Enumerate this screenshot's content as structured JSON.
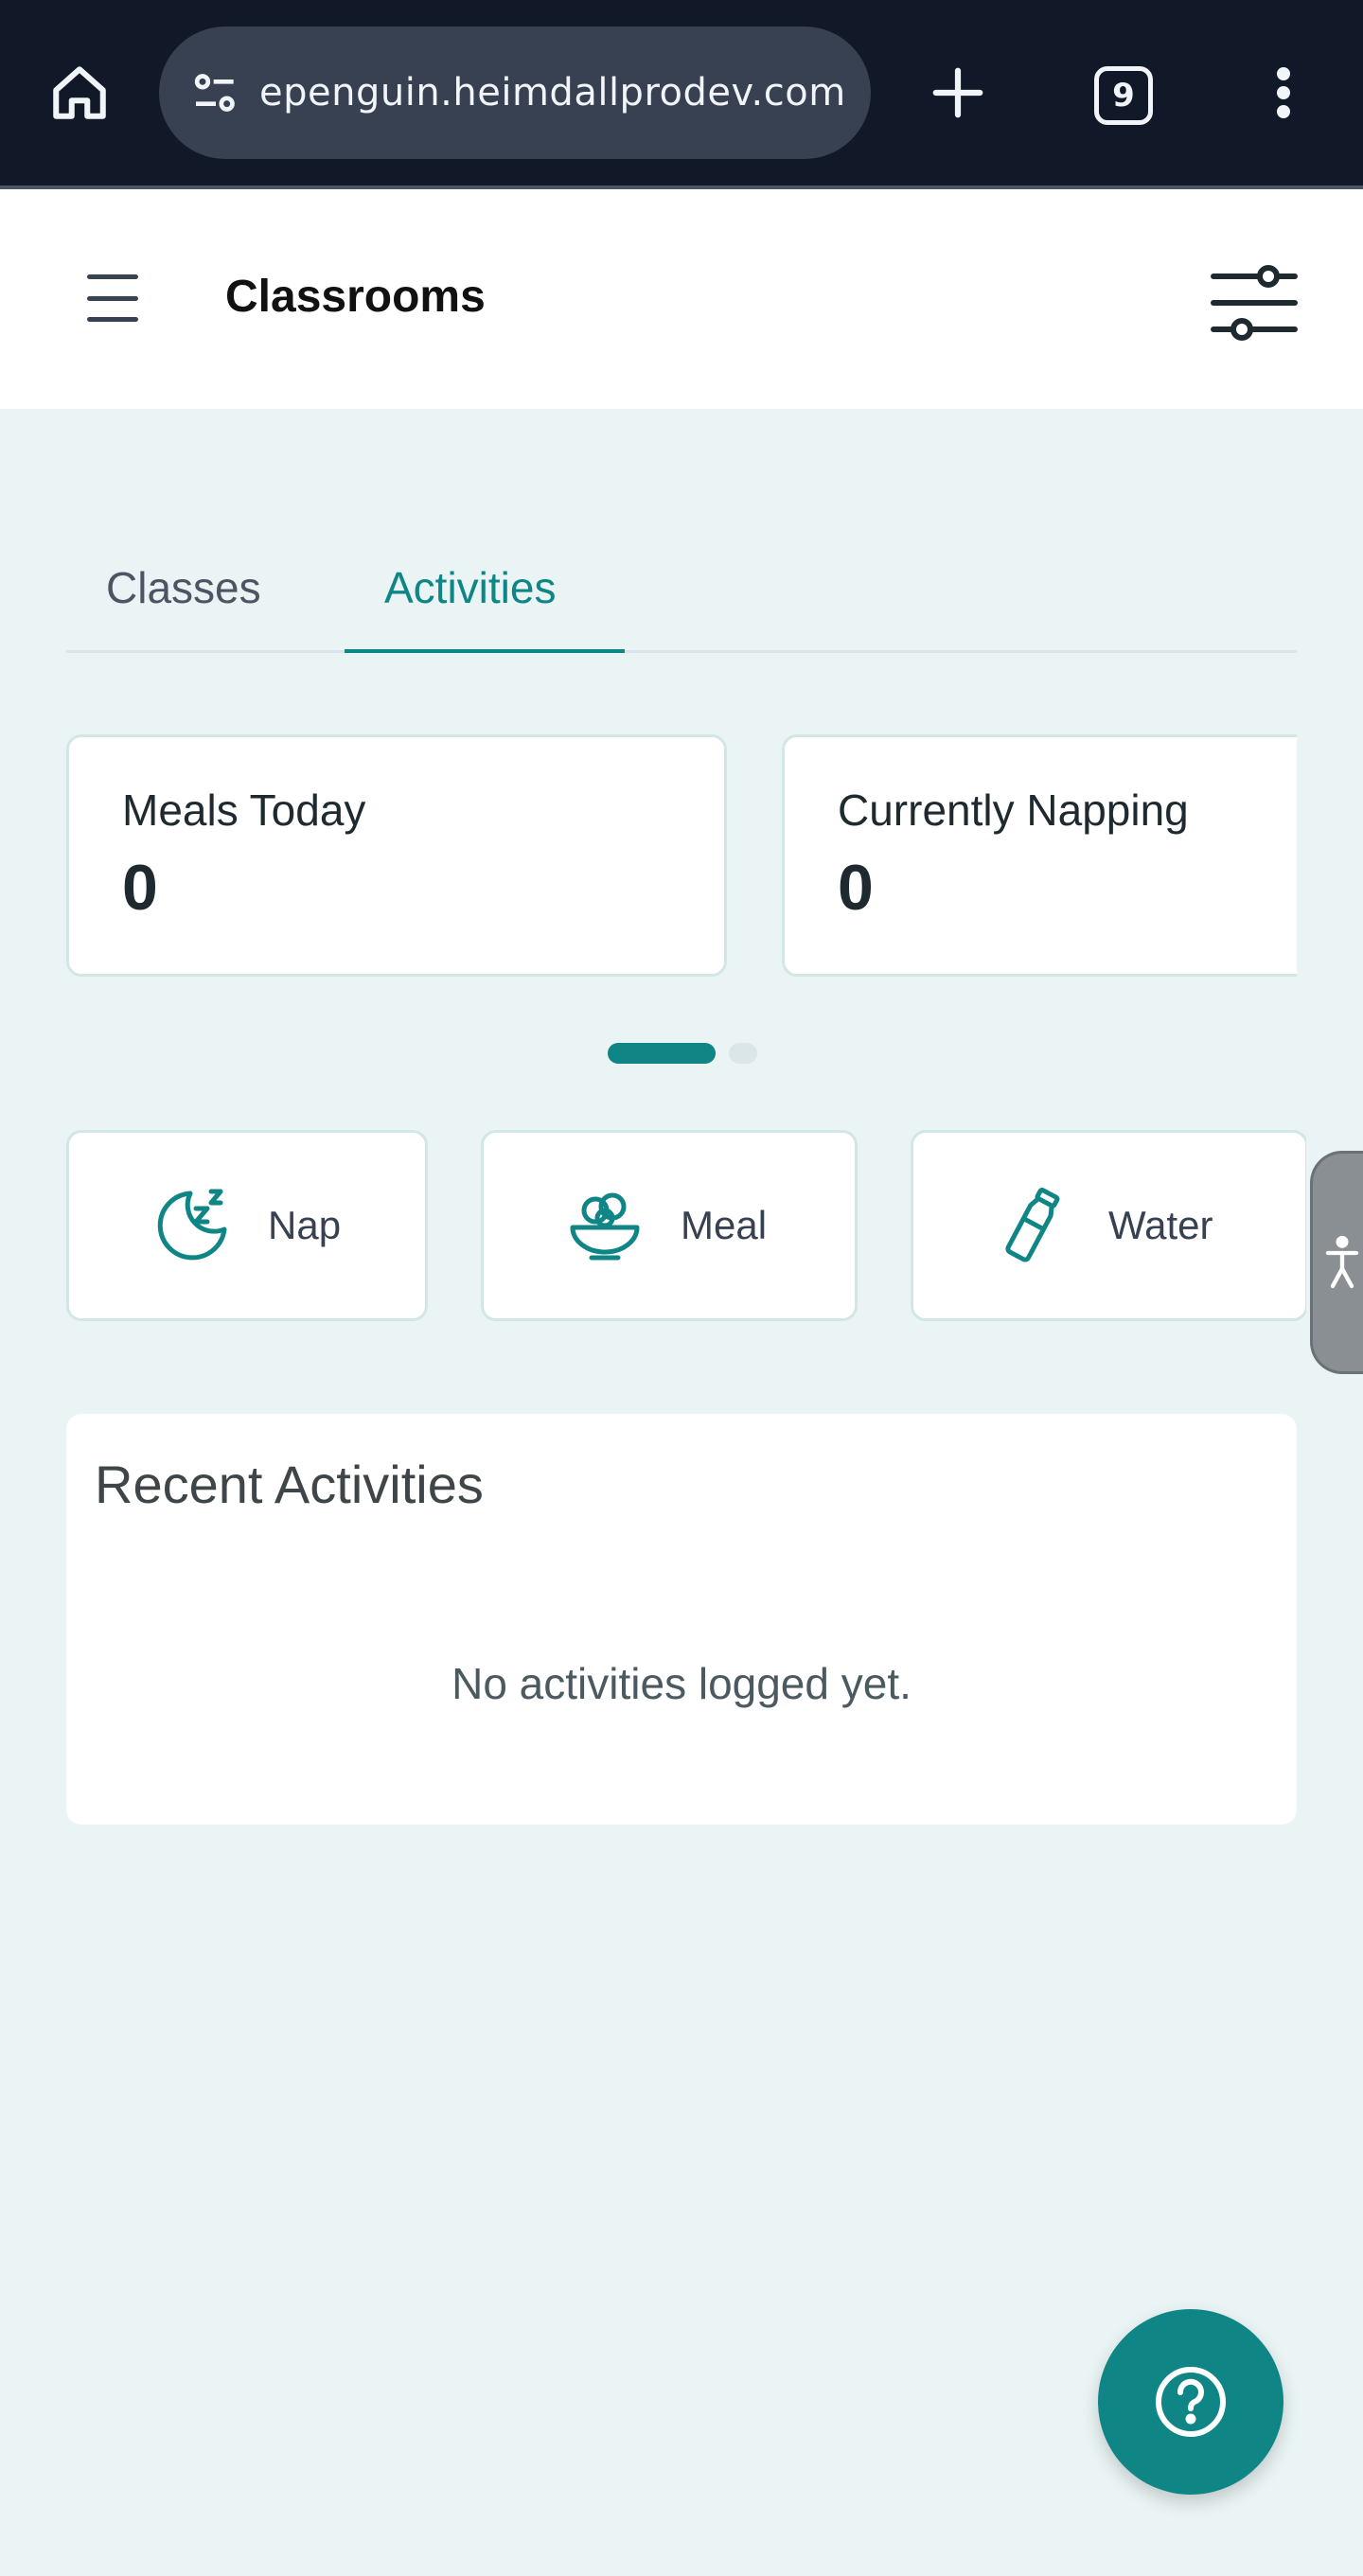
{
  "browser": {
    "url": "epenguin.heimdallprodev.com",
    "tab_count": "9"
  },
  "header": {
    "title": "Classrooms"
  },
  "tabs": [
    {
      "label": "Classes",
      "active": false
    },
    {
      "label": "Activities",
      "active": true
    }
  ],
  "stats": [
    {
      "label": "Meals Today",
      "value": "0"
    },
    {
      "label": "Currently Napping",
      "value": "0"
    }
  ],
  "carousel": {
    "pages": 2,
    "current": 1
  },
  "actions": [
    {
      "label": "Nap",
      "icon": "moon-zzz-icon"
    },
    {
      "label": "Meal",
      "icon": "food-bowl-icon"
    },
    {
      "label": "Water",
      "icon": "water-bottle-icon"
    }
  ],
  "recent": {
    "heading": "Recent Activities",
    "empty_message": "No activities logged yet."
  },
  "colors": {
    "accent": "#0f8585",
    "page_bg": "#eaf4f4",
    "browser_bar": "#111827"
  }
}
